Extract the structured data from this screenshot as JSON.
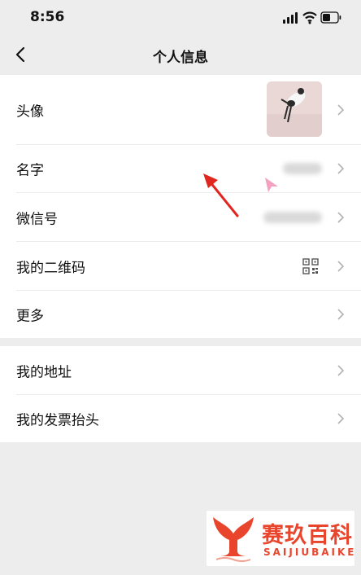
{
  "status_bar": {
    "time": "8:56",
    "icons": [
      "cellular-signal-icon",
      "wifi-icon",
      "battery-icon"
    ]
  },
  "nav": {
    "title": "个人信息",
    "back_icon": "chevron-left-icon"
  },
  "profile_group": {
    "rows": [
      {
        "label": "头像",
        "value_type": "avatar-image"
      },
      {
        "label": "名字",
        "value_type": "blurred-text"
      },
      {
        "label": "微信号",
        "value_type": "blurred-text"
      },
      {
        "label": "我的二维码",
        "value_type": "qr-code-icon"
      },
      {
        "label": "更多",
        "value_type": "none"
      }
    ]
  },
  "secondary_group": {
    "rows": [
      {
        "label": "我的地址"
      },
      {
        "label": "我的发票抬头"
      }
    ]
  },
  "overlays": {
    "annotation_arrow_color": "#e0261f",
    "cursor_color": "#f28fb5"
  },
  "watermark": {
    "chinese": "赛玖百科",
    "english": "SAIJIUBAIKE",
    "color": "#e8452c"
  },
  "colors": {
    "background": "#ededed",
    "card": "#ffffff",
    "chevron": "#b2b2b2"
  }
}
